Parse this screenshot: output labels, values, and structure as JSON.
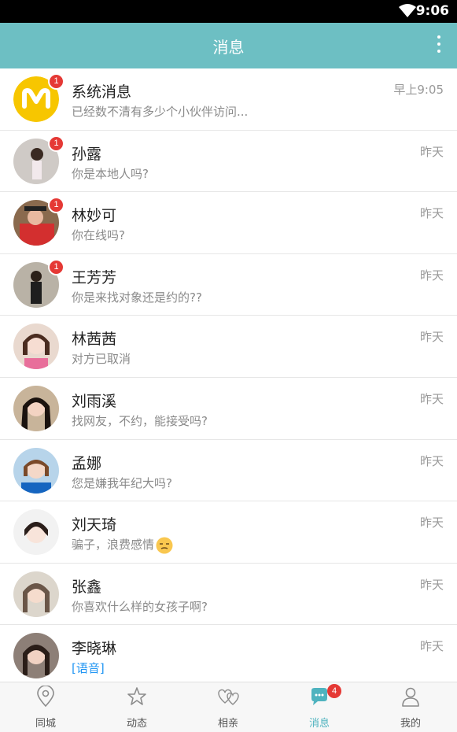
{
  "status_bar": {
    "time": "9:06",
    "wifi_icon": "wifi-icon"
  },
  "app_bar": {
    "title": "消息",
    "menu_icon": "more-vert-icon"
  },
  "conversations": [
    {
      "name": "系统消息",
      "preview": "已经数不清有多少个小伙伴访问...",
      "time": "早上9:05",
      "badge": "1",
      "avatar": "system-logo"
    },
    {
      "name": "孙露",
      "preview": "你是本地人吗?",
      "time": "昨天",
      "badge": "1",
      "avatar": "user-photo"
    },
    {
      "name": "林妙可",
      "preview": "你在线吗?",
      "time": "昨天",
      "badge": "1",
      "avatar": "user-photo"
    },
    {
      "name": "王芳芳",
      "preview": "你是来找对象还是约的??",
      "time": "昨天",
      "badge": "1",
      "avatar": "user-photo"
    },
    {
      "name": "林茜茜",
      "preview": "对方已取消",
      "time": "昨天",
      "badge": "",
      "avatar": "user-photo"
    },
    {
      "name": "刘雨溪",
      "preview": "找网友，不约，能接受吗?",
      "time": "昨天",
      "badge": "",
      "avatar": "user-photo"
    },
    {
      "name": "孟娜",
      "preview": "您是嫌我年纪大吗?",
      "time": "昨天",
      "badge": "",
      "avatar": "user-photo"
    },
    {
      "name": "刘天琦",
      "preview": "骗子，浪费感情",
      "time": "昨天",
      "badge": "",
      "avatar": "user-photo",
      "emoji": "unamused-face-icon"
    },
    {
      "name": "张鑫",
      "preview": "你喜欢什么样的女孩子啊?",
      "time": "昨天",
      "badge": "",
      "avatar": "user-photo"
    },
    {
      "name": "李晓琳",
      "preview": "[语音]",
      "time": "昨天",
      "badge": "",
      "avatar": "user-photo",
      "voice": true
    }
  ],
  "tab_bar": {
    "tabs": [
      {
        "label": "同城",
        "icon": "location-pin-icon"
      },
      {
        "label": "动态",
        "icon": "star-icon"
      },
      {
        "label": "相亲",
        "icon": "hearts-icon"
      },
      {
        "label": "消息",
        "icon": "chat-bubble-icon",
        "badge": "4",
        "active": true
      },
      {
        "label": "我的",
        "icon": "person-icon"
      }
    ]
  },
  "colors": {
    "accent": "#6dbfc3",
    "badge": "#e53935",
    "voice_link": "#2196f3",
    "system_logo": "#f7c600"
  }
}
